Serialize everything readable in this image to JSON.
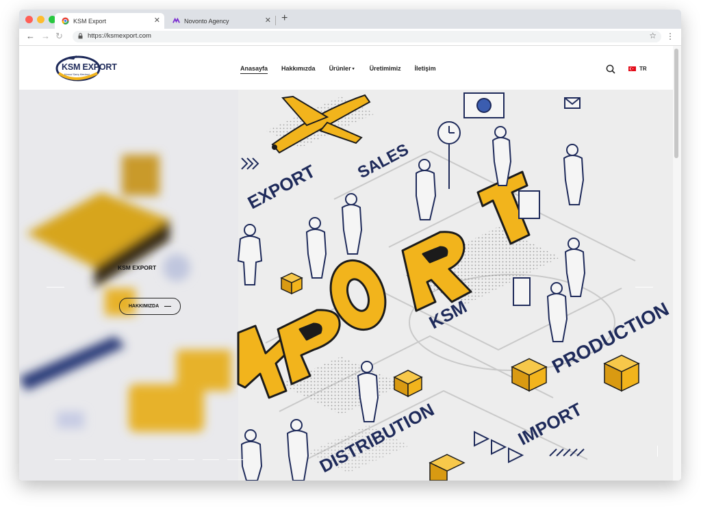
{
  "browser": {
    "tabs": [
      {
        "title": "KSM Export",
        "active": true
      },
      {
        "title": "Novonto Agency",
        "active": false
      }
    ],
    "url": "https://ksmexport.com"
  },
  "site": {
    "logo_text": "KSM EXPORT",
    "logo_tagline": "Kemal Satış Merkezi",
    "nav": [
      "Anasayfa",
      "Hakkımızda",
      "Ürünler",
      "Üretimimiz",
      "İletişim"
    ],
    "lang": "TR"
  },
  "hero": {
    "slide_title": "KSM EXPORT",
    "button_label": "HAKKIMIZDA",
    "words": {
      "export": "EXPORT",
      "sales": "SALES",
      "ksm": "KSM",
      "production": "PRODUCTION",
      "distribution": "DISTRIBUTION",
      "import": "IMPORT",
      "big_letters": [
        "X",
        "P",
        "O",
        "R",
        "T"
      ]
    }
  },
  "colors": {
    "accent": "#f2b41c",
    "navy": "#1e2a5a",
    "hero_bg": "#ededed"
  }
}
